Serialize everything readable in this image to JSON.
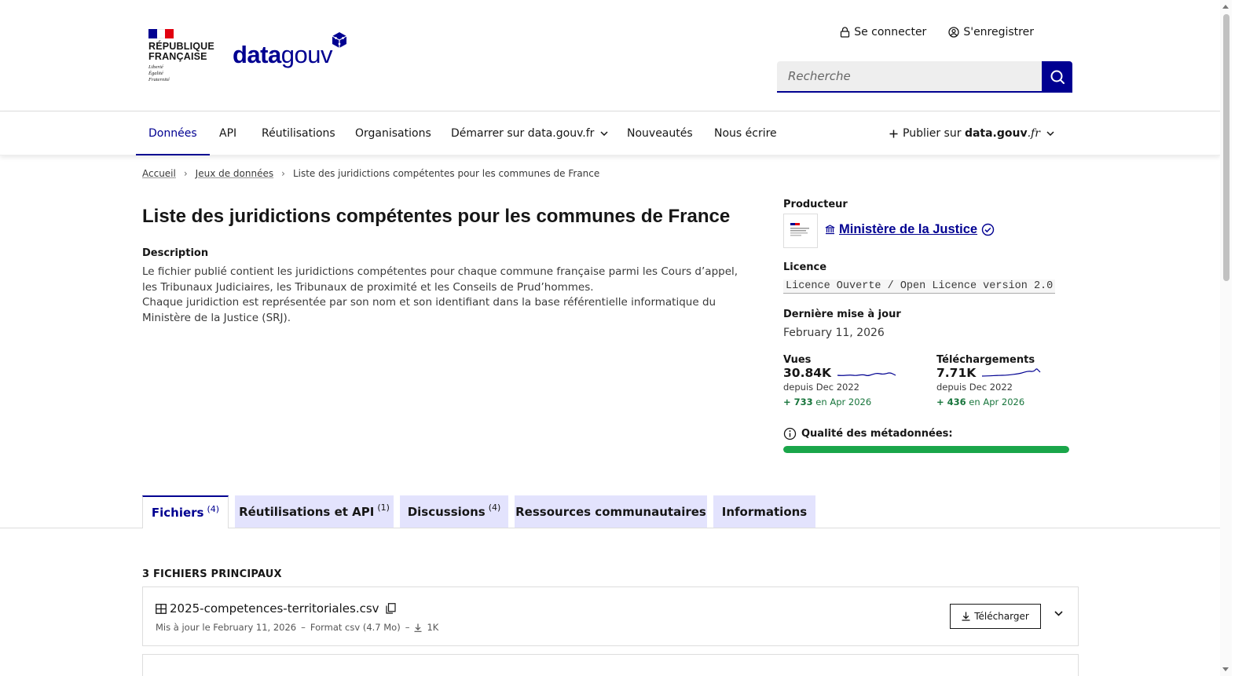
{
  "header": {
    "rf_line1": "RÉPUBLIQUE",
    "rf_line2": "FRANÇAISE",
    "devise_1": "Liberté",
    "devise_2": "Égalité",
    "devise_3": "Fraternité",
    "logo_data": "data",
    "logo_gouv": "gouv",
    "login": "Se connecter",
    "register": "S'enregistrer",
    "search_placeholder": "Recherche",
    "colors": {
      "brand": "#000091",
      "flag_blue": "#000091",
      "flag_red": "#e1000f"
    }
  },
  "nav": {
    "items": [
      "Données",
      "API",
      "Réutilisations",
      "Organisations",
      "Démarrer sur data.gouv.fr",
      "Nouveautés",
      "Nous écrire"
    ],
    "active": "Données",
    "publish_prefix": "Publier sur ",
    "publish_brand": "data.gouv",
    "publish_suffix": ".fr"
  },
  "breadcrumb": {
    "home": "Accueil",
    "datasets": "Jeux de données",
    "current": "Liste des juridictions compétentes pour les communes de France"
  },
  "dataset": {
    "title": "Liste des juridictions compétentes pour les communes de France",
    "description_label": "Description",
    "description_1": "Le fichier publié contient les juridictions compétentes pour chaque commune française parmi les Cours d’appel, les Tribunaux Judiciaires, les Tribunaux de proximité et les Conseils de Prud’hommes.",
    "description_2": "Chaque juridiction est représentée par son nom et son identifiant dans la base référentielle informatique du Ministère de la Justice (SRJ)."
  },
  "sidebar": {
    "producer_label": "Producteur",
    "producer_name": "Ministère de la Justice",
    "licence_label": "Licence",
    "licence_value": "Licence Ouverte / Open Licence version 2.0",
    "updated_label": "Dernière mise à jour",
    "updated_value": "February 11, 2026",
    "views_label": "Vues",
    "views_value": "30.84K",
    "views_since": "depuis Dec 2022",
    "views_delta": "+ 733",
    "views_delta_suffix": " en Apr 2026",
    "downloads_label": "Téléchargements",
    "downloads_value": "7.71K",
    "downloads_since": "depuis Dec 2022",
    "downloads_delta": "+ 436",
    "downloads_delta_suffix": " en Apr 2026",
    "quality_label": "Qualité des métadonnées:",
    "quality_fraction": 1.0
  },
  "tabs": [
    {
      "label": "Fichiers",
      "count": "(4)"
    },
    {
      "label": "Réutilisations et API",
      "count": "(1)"
    },
    {
      "label": "Discussions",
      "count": "(4)"
    },
    {
      "label": "Ressources communautaires",
      "count": ""
    },
    {
      "label": "Informations",
      "count": ""
    }
  ],
  "files": {
    "section_title": "3 FICHIERS PRINCIPAUX",
    "first": {
      "name": "2025-competences-territoriales.csv",
      "updated": "Mis à jour le February 11, 2026",
      "format": "Format csv (4.7 Mo)",
      "downloads": "1K",
      "download_label": "Télécharger"
    }
  }
}
